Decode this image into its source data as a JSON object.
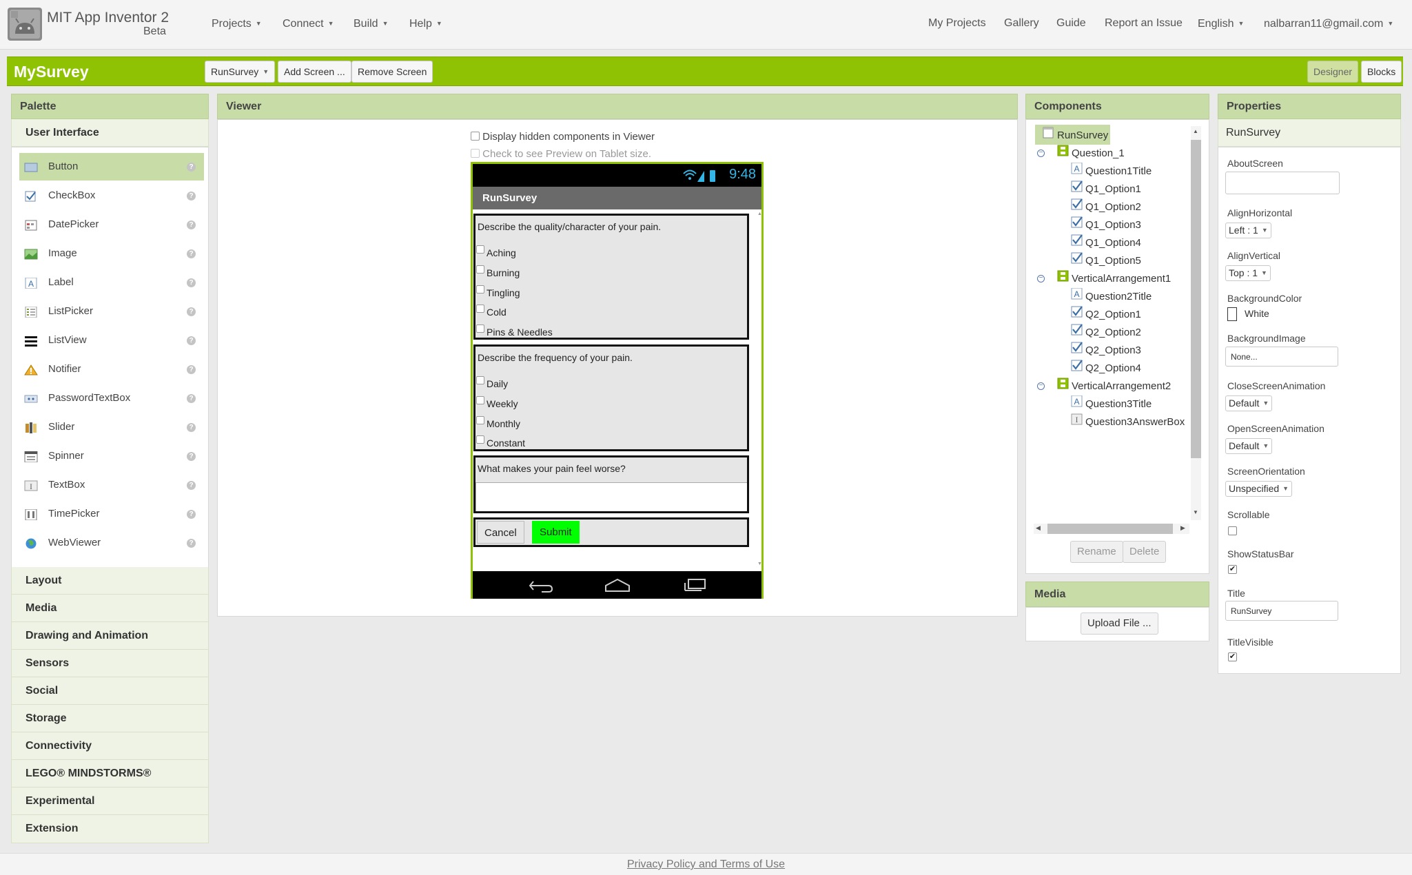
{
  "header": {
    "app_name": "MIT App Inventor 2",
    "app_subtitle": "Beta",
    "nav": [
      "Projects",
      "Connect",
      "Build",
      "Help"
    ],
    "right_nav": [
      "My Projects",
      "Gallery",
      "Guide",
      "Report an Issue"
    ],
    "language": "English",
    "account": "nalbarran11@gmail.com"
  },
  "titlebar": {
    "project_name": "MySurvey",
    "screen_select": "RunSurvey",
    "add_screen": "Add Screen ...",
    "remove_screen": "Remove Screen",
    "designer": "Designer",
    "blocks": "Blocks"
  },
  "palette": {
    "title": "Palette",
    "open_category": "User Interface",
    "items": [
      "Button",
      "CheckBox",
      "DatePicker",
      "Image",
      "Label",
      "ListPicker",
      "ListView",
      "Notifier",
      "PasswordTextBox",
      "Slider",
      "Spinner",
      "TextBox",
      "TimePicker",
      "WebViewer"
    ],
    "help_glyph": "?",
    "categories": [
      "Layout",
      "Media",
      "Drawing and Animation",
      "Sensors",
      "Social",
      "Storage",
      "Connectivity",
      "LEGO® MINDSTORMS®",
      "Experimental",
      "Extension"
    ]
  },
  "viewer": {
    "title": "Viewer",
    "hidden_components": "Display hidden components in Viewer",
    "tablet_preview": "Check to see Preview on Tablet size.",
    "phone": {
      "time": "9:48",
      "screen_title": "RunSurvey",
      "q1_title": "Describe the quality/character of your pain.",
      "q1_options": [
        "Aching",
        "Burning",
        "Tingling",
        "Cold",
        "Pins & Needles"
      ],
      "q2_title": "Describe the frequency of your pain.",
      "q2_options": [
        "Daily",
        "Weekly",
        "Monthly",
        "Constant"
      ],
      "q3_title": "What makes your pain feel worse?",
      "cancel": "Cancel",
      "submit": "Submit"
    }
  },
  "components": {
    "title": "Components",
    "root": "RunSurvey",
    "tree": [
      {
        "name": "Question_1",
        "level": 0,
        "type": "arrangement"
      },
      {
        "name": "Question1Title",
        "level": 1,
        "type": "label"
      },
      {
        "name": "Q1_Option1",
        "level": 1,
        "type": "checkbox"
      },
      {
        "name": "Q1_Option2",
        "level": 1,
        "type": "checkbox"
      },
      {
        "name": "Q1_Option3",
        "level": 1,
        "type": "checkbox"
      },
      {
        "name": "Q1_Option4",
        "level": 1,
        "type": "checkbox"
      },
      {
        "name": "Q1_Option5",
        "level": 1,
        "type": "checkbox"
      },
      {
        "name": "VerticalArrangement1",
        "level": 0,
        "type": "arrangement"
      },
      {
        "name": "Question2Title",
        "level": 1,
        "type": "label"
      },
      {
        "name": "Q2_Option1",
        "level": 1,
        "type": "checkbox"
      },
      {
        "name": "Q2_Option2",
        "level": 1,
        "type": "checkbox"
      },
      {
        "name": "Q2_Option3",
        "level": 1,
        "type": "checkbox"
      },
      {
        "name": "Q2_Option4",
        "level": 1,
        "type": "checkbox"
      },
      {
        "name": "VerticalArrangement2",
        "level": 0,
        "type": "arrangement"
      },
      {
        "name": "Question3Title",
        "level": 1,
        "type": "label"
      },
      {
        "name": "Question3AnswerBox",
        "level": 1,
        "type": "textbox"
      }
    ],
    "rename": "Rename",
    "delete": "Delete"
  },
  "media": {
    "title": "Media",
    "upload": "Upload File ..."
  },
  "properties": {
    "title": "Properties",
    "component": "RunSurvey",
    "about_screen_label": "AboutScreen",
    "about_screen_value": "",
    "align_horizontal_label": "AlignHorizontal",
    "align_horizontal_value": "Left : 1",
    "align_vertical_label": "AlignVertical",
    "align_vertical_value": "Top : 1",
    "background_color_label": "BackgroundColor",
    "background_color_value": "White",
    "background_image_label": "BackgroundImage",
    "background_image_value": "None...",
    "close_anim_label": "CloseScreenAnimation",
    "close_anim_value": "Default",
    "open_anim_label": "OpenScreenAnimation",
    "open_anim_value": "Default",
    "orientation_label": "ScreenOrientation",
    "orientation_value": "Unspecified",
    "scrollable_label": "Scrollable",
    "scrollable_checked": false,
    "show_status_label": "ShowStatusBar",
    "show_status_checked": true,
    "title_label": "Title",
    "title_value": "RunSurvey",
    "title_visible_label": "TitleVisible",
    "title_visible_checked": true
  },
  "footer": {
    "link": "Privacy Policy and Terms of Use"
  },
  "colors": {
    "accent_green": "#8fc202",
    "submit_green": "#00ff00",
    "phone_clock": "#33b5e5"
  }
}
